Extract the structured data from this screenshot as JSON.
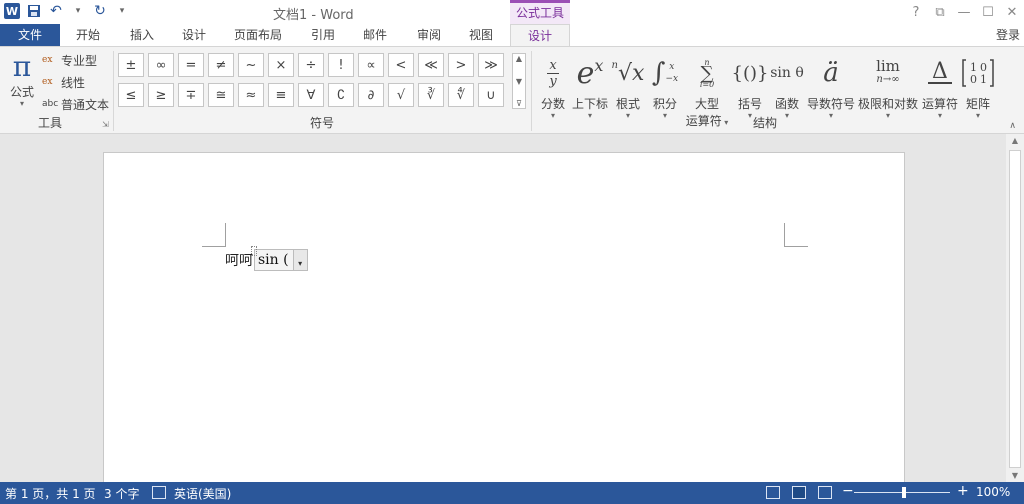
{
  "titlebar": {
    "logo": "W",
    "doc_title": "文档1 - Word",
    "context_tool": "公式工具",
    "controls": [
      "?",
      "⧉",
      "—",
      "☐",
      "✕"
    ]
  },
  "tabs": {
    "file": "文件",
    "items": [
      "开始",
      "插入",
      "设计",
      "页面布局",
      "引用",
      "邮件",
      "审阅",
      "视图"
    ],
    "active": "设计",
    "login": "登录"
  },
  "ribbon": {
    "tools": {
      "formula_label": "公式",
      "professional": "专业型",
      "linear": "线性",
      "normal_text": "普通文本",
      "normal_text_icon": "abc",
      "group_label": "工具"
    },
    "symbols": {
      "group_label": "符号",
      "row1": [
        "±",
        "∞",
        "=",
        "≠",
        "~",
        "×",
        "÷",
        "!",
        "∝",
        "<",
        "≪",
        ">",
        "≫"
      ],
      "row2": [
        "≤",
        "≥",
        "∓",
        "≅",
        "≈",
        "≡",
        "∀",
        "∁",
        "∂",
        "√",
        "∛",
        "∜",
        "∪"
      ]
    },
    "structures": {
      "group_label": "结构",
      "items": [
        {
          "label": "分数",
          "icon": "fraction-icon"
        },
        {
          "label": "上下标",
          "icon": "script-icon"
        },
        {
          "label": "根式",
          "icon": "radical-icon"
        },
        {
          "label": "积分",
          "icon": "integral-icon"
        },
        {
          "label": "大型运算符",
          "line1": "大型",
          "line2": "运算符",
          "icon": "large-operator-icon"
        },
        {
          "label": "括号",
          "icon": "bracket-icon"
        },
        {
          "label": "函数",
          "icon": "function-icon"
        },
        {
          "label": "导数符号",
          "icon": "accent-icon"
        },
        {
          "label": "极限和对数",
          "icon": "limit-icon"
        },
        {
          "label": "运算符",
          "icon": "operator-icon"
        },
        {
          "label": "矩阵",
          "icon": "matrix-icon"
        }
      ],
      "glyphs": {
        "frac_num": "x",
        "frac_den": "y",
        "script_base": "e",
        "script_sup": "x",
        "radical_index": "n",
        "radical_base": "√x",
        "integral_upper": "x",
        "integral_lower": "−x",
        "sum_upper": "n",
        "sum_lower": "i=0",
        "bracket": "{()}",
        "function": "sin θ",
        "accent": "ä",
        "limit_top": "lim",
        "limit_bottom": "n→∞",
        "operator": "Δ",
        "matrix": "[1 0 / 0 1]"
      }
    }
  },
  "document": {
    "text": "呵呵",
    "equation": "sin (",
    "dropdown_icon": "▾"
  },
  "statusbar": {
    "page": "第 1 页，共 1 页",
    "words": "3 个字",
    "language": "英语(美国)",
    "zoom": "100%",
    "zoom_minus": "−",
    "zoom_plus": "+",
    "zoom_value": 1.0
  }
}
